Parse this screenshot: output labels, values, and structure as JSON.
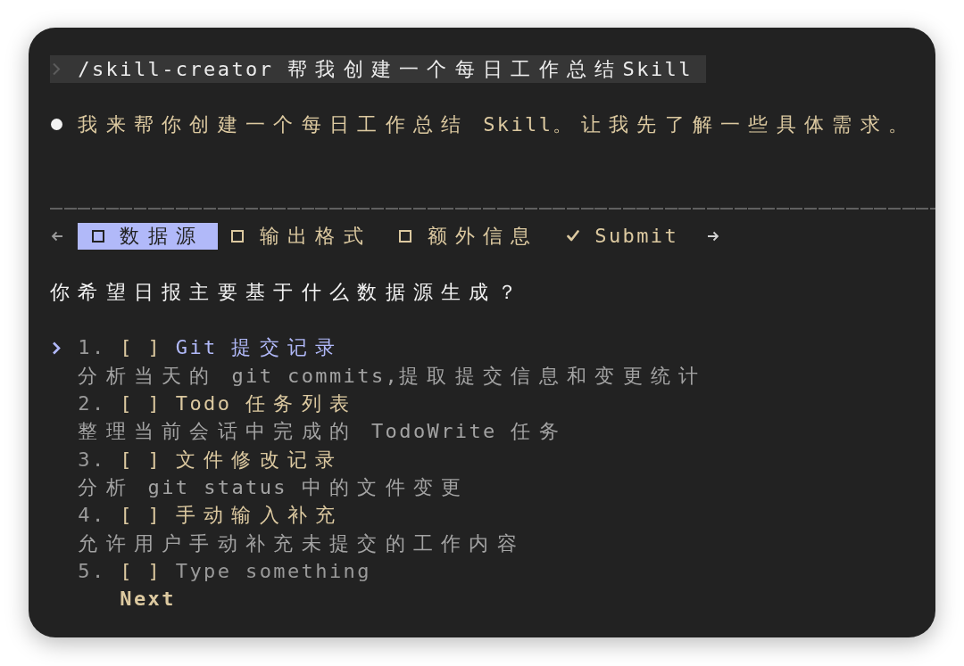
{
  "prompt": {
    "text": "/skill-creator 帮我创建一个每日工作总结Skill"
  },
  "message": {
    "text": "我来帮你创建一个每日工作总结 Skill。让我先了解一些具体需求。"
  },
  "tabs": [
    {
      "kind": "question",
      "label": "数据源",
      "selected": true
    },
    {
      "kind": "question",
      "label": "输出格式",
      "selected": false
    },
    {
      "kind": "question",
      "label": "额外信息",
      "selected": false
    },
    {
      "kind": "submit",
      "label": "Submit",
      "selected": false
    }
  ],
  "question": {
    "text": "你希望日报主要基于什么数据源生成？"
  },
  "options": [
    {
      "kind": "choice",
      "number": "1.",
      "checkbox": "[ ]",
      "label": "Git 提交记录",
      "description": "分析当天的 git commits,提取提交信息和变更统计",
      "selected": true
    },
    {
      "kind": "choice",
      "number": "2.",
      "checkbox": "[ ]",
      "label": "Todo 任务列表",
      "description": "整理当前会话中完成的 TodoWrite 任务",
      "selected": false
    },
    {
      "kind": "choice",
      "number": "3.",
      "checkbox": "[ ]",
      "label": "文件修改记录",
      "description": "分析 git status 中的文件变更",
      "selected": false
    },
    {
      "kind": "choice",
      "number": "4.",
      "checkbox": "[ ]",
      "label": "手动输入补充",
      "description": "允许用户手动补充未提交的工作内容",
      "selected": false
    },
    {
      "kind": "input",
      "number": "5.",
      "checkbox": "[ ]",
      "placeholder": "Type something",
      "selected": false
    }
  ],
  "next": {
    "label": "Next"
  }
}
